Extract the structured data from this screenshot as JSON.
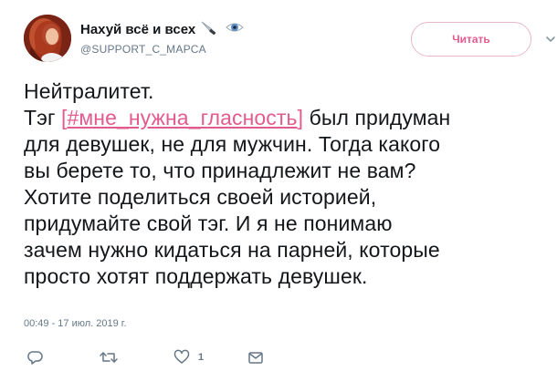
{
  "user": {
    "display_name": "Нахуй всё и всех",
    "emoji": [
      "knife-icon",
      "eye-icon"
    ],
    "handle": "@SUPPORT_C_MAPCA"
  },
  "follow_button": {
    "label": "Читать"
  },
  "tweet": {
    "lines": [
      "Нейтралитет.",
      "для девушек, не для мужчин. Тогда какого",
      "вы берете то, что принадлежит не вам?",
      "Хотите поделиться своей историей,",
      "придумайте свой тэг. И я не понимаю",
      "зачем нужно кидаться на парней, которые",
      "просто хотят поддержать девушек."
    ],
    "line2_prefix": "Тэг ",
    "line2_bracket_open": "[",
    "hashtag": "#мне_нужна_гласность",
    "line2_bracket_close": "]",
    "line2_suffix": " был придуман"
  },
  "timestamp": "00:49 - 17 июл. 2019 г.",
  "actions": {
    "reply_icon": "reply-icon",
    "retweet_icon": "retweet-icon",
    "like_icon": "heart-icon",
    "like_count": "1",
    "dm_icon": "envelope-icon"
  },
  "colors": {
    "accent": "#e25b8e",
    "secondary_text": "#657786",
    "text": "#14171a"
  }
}
